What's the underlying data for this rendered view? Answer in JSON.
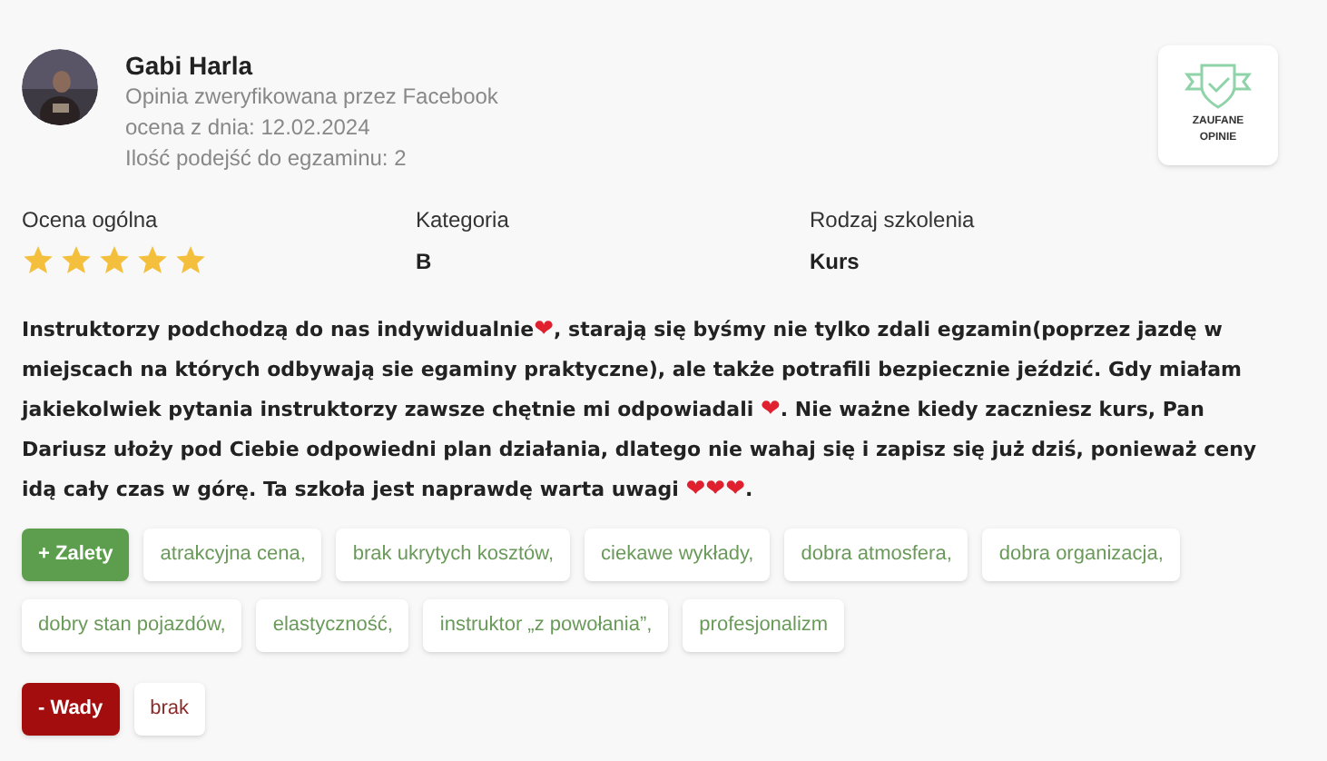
{
  "reviewer": {
    "name": "Gabi Harla",
    "verified": "Opinia zweryfikowana przez Facebook",
    "date": "ocena z dnia: 12.02.2024",
    "attempts": "Ilość podejść do egzaminu: 2"
  },
  "badge": {
    "line_1": "ZAUFANE",
    "line_2": "OPINIE"
  },
  "ratings": [
    {
      "kind": "stars",
      "label": "Ocena ogólna",
      "stars": 5
    },
    {
      "kind": "text",
      "label": "Kategoria",
      "value": "B"
    },
    {
      "kind": "text",
      "label": "Rodzaj szkolenia",
      "value": "Kurs"
    }
  ],
  "review": [
    {
      "kind": "text",
      "text": "Instruktorzy podchodzą do nas indywidualnie"
    },
    {
      "kind": "heart",
      "text": "❤"
    },
    {
      "kind": "text",
      "text": ", starają się byśmy nie tylko zdali egzamin(poprzez jazdę w miejscach na których odbywają sie egaminy praktyczne), ale także potrafili bezpiecznie jeździć. Gdy miałam jakiekolwiek pytania instruktorzy zawsze chętnie mi odpowiadali "
    },
    {
      "kind": "heart",
      "text": "❤"
    },
    {
      "kind": "text",
      "text": ". Nie ważne kiedy zaczniesz kurs, Pan Dariusz ułoży pod Ciebie odpowiedni plan działania, dlatego nie wahaj się i zapisz się już dziś, ponieważ ceny idą cały czas w górę. Ta szkoła jest naprawdę warta uwagi "
    },
    {
      "kind": "heart",
      "text": "❤"
    },
    {
      "kind": "heart",
      "text": "❤"
    },
    {
      "kind": "heart",
      "text": "❤"
    },
    {
      "kind": "text",
      "text": "."
    }
  ],
  "groups": [
    {
      "kind": "pros",
      "label": "+ Zalety",
      "tags": [
        "atrakcyjna cena,",
        "brak ukrytych kosztów,",
        "ciekawe wykłady,",
        "dobra atmosfera,",
        "dobra organizacja,",
        "dobry stan pojazdów,",
        "elastyczność,",
        "instruktor „z powołania”,",
        "profesjonalizm"
      ]
    },
    {
      "kind": "cons",
      "label": "- Wady",
      "tags": [
        "brak"
      ]
    }
  ]
}
